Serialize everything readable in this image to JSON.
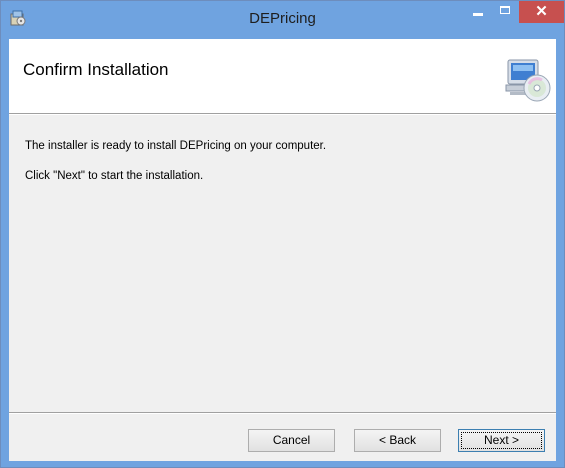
{
  "window": {
    "title": "DEPricing",
    "close_glyph": "✕",
    "accent_color": "#6fa3e0",
    "close_color": "#c7504f"
  },
  "banner": {
    "title": "Confirm Installation",
    "icon": "computer-cd-icon"
  },
  "body": {
    "line1": "The installer is ready to install DEPricing on your computer.",
    "line2": "Click \"Next\" to start the installation."
  },
  "buttons": {
    "cancel": "Cancel",
    "back": "< Back",
    "next": "Next >"
  },
  "icons": {
    "app": "installer-icon",
    "minimize": "minimize-icon",
    "maximize": "maximize-icon",
    "close": "close-icon"
  }
}
